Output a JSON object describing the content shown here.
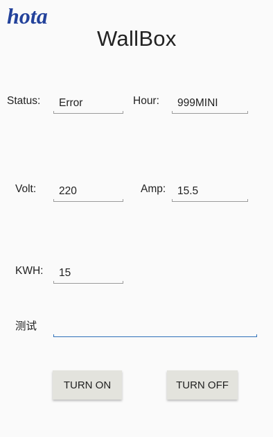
{
  "brand": {
    "logo_text": "hota"
  },
  "app": {
    "title": "WallBox"
  },
  "status": {
    "label": "Status:",
    "value": "Error"
  },
  "hour": {
    "label": "Hour:",
    "value": "999MINI"
  },
  "volt": {
    "label": "Volt:",
    "value": "220"
  },
  "amp": {
    "label": "Amp:",
    "value": "15.5"
  },
  "kwh": {
    "label": "KWH:",
    "value": "15"
  },
  "test": {
    "label": "测试",
    "value": ""
  },
  "buttons": {
    "turn_on": "TURN ON",
    "turn_off": "TURN OFF"
  },
  "colors": {
    "logo": "#23429b",
    "focus_underline": "#2d6fb8",
    "button_bg": "#e3e3dd"
  }
}
